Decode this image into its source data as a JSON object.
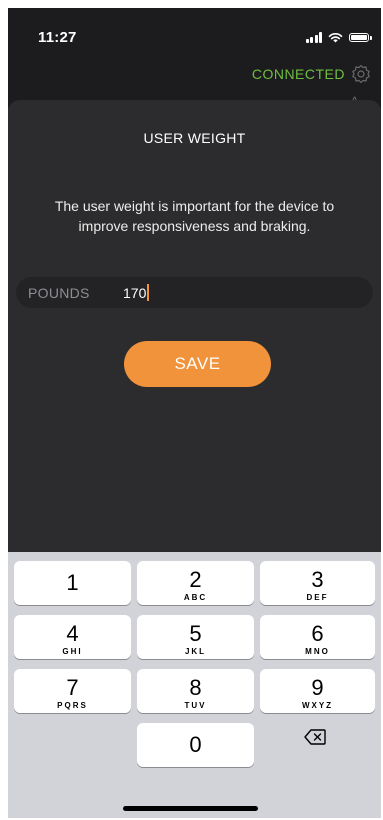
{
  "status_bar": {
    "time": "11:27"
  },
  "header": {
    "connection_status": "CONNECTED",
    "small_mark": "^"
  },
  "dialog": {
    "title": "USER WEIGHT",
    "description": "The user weight is important for the device to improve responsiveness and braking.",
    "input": {
      "label": "POUNDS",
      "value": "170"
    },
    "save_label": "SAVE"
  },
  "keypad": {
    "keys": [
      {
        "num": "1",
        "letters": ""
      },
      {
        "num": "2",
        "letters": "ABC"
      },
      {
        "num": "3",
        "letters": "DEF"
      },
      {
        "num": "4",
        "letters": "GHI"
      },
      {
        "num": "5",
        "letters": "JKL"
      },
      {
        "num": "6",
        "letters": "MNO"
      },
      {
        "num": "7",
        "letters": "PQRS"
      },
      {
        "num": "8",
        "letters": "TUV"
      },
      {
        "num": "9",
        "letters": "WXYZ"
      },
      {
        "num": "0",
        "letters": ""
      }
    ]
  },
  "colors": {
    "accent": "#f0933a",
    "connected": "#6fbf3f",
    "background": "#2c2c2e"
  }
}
